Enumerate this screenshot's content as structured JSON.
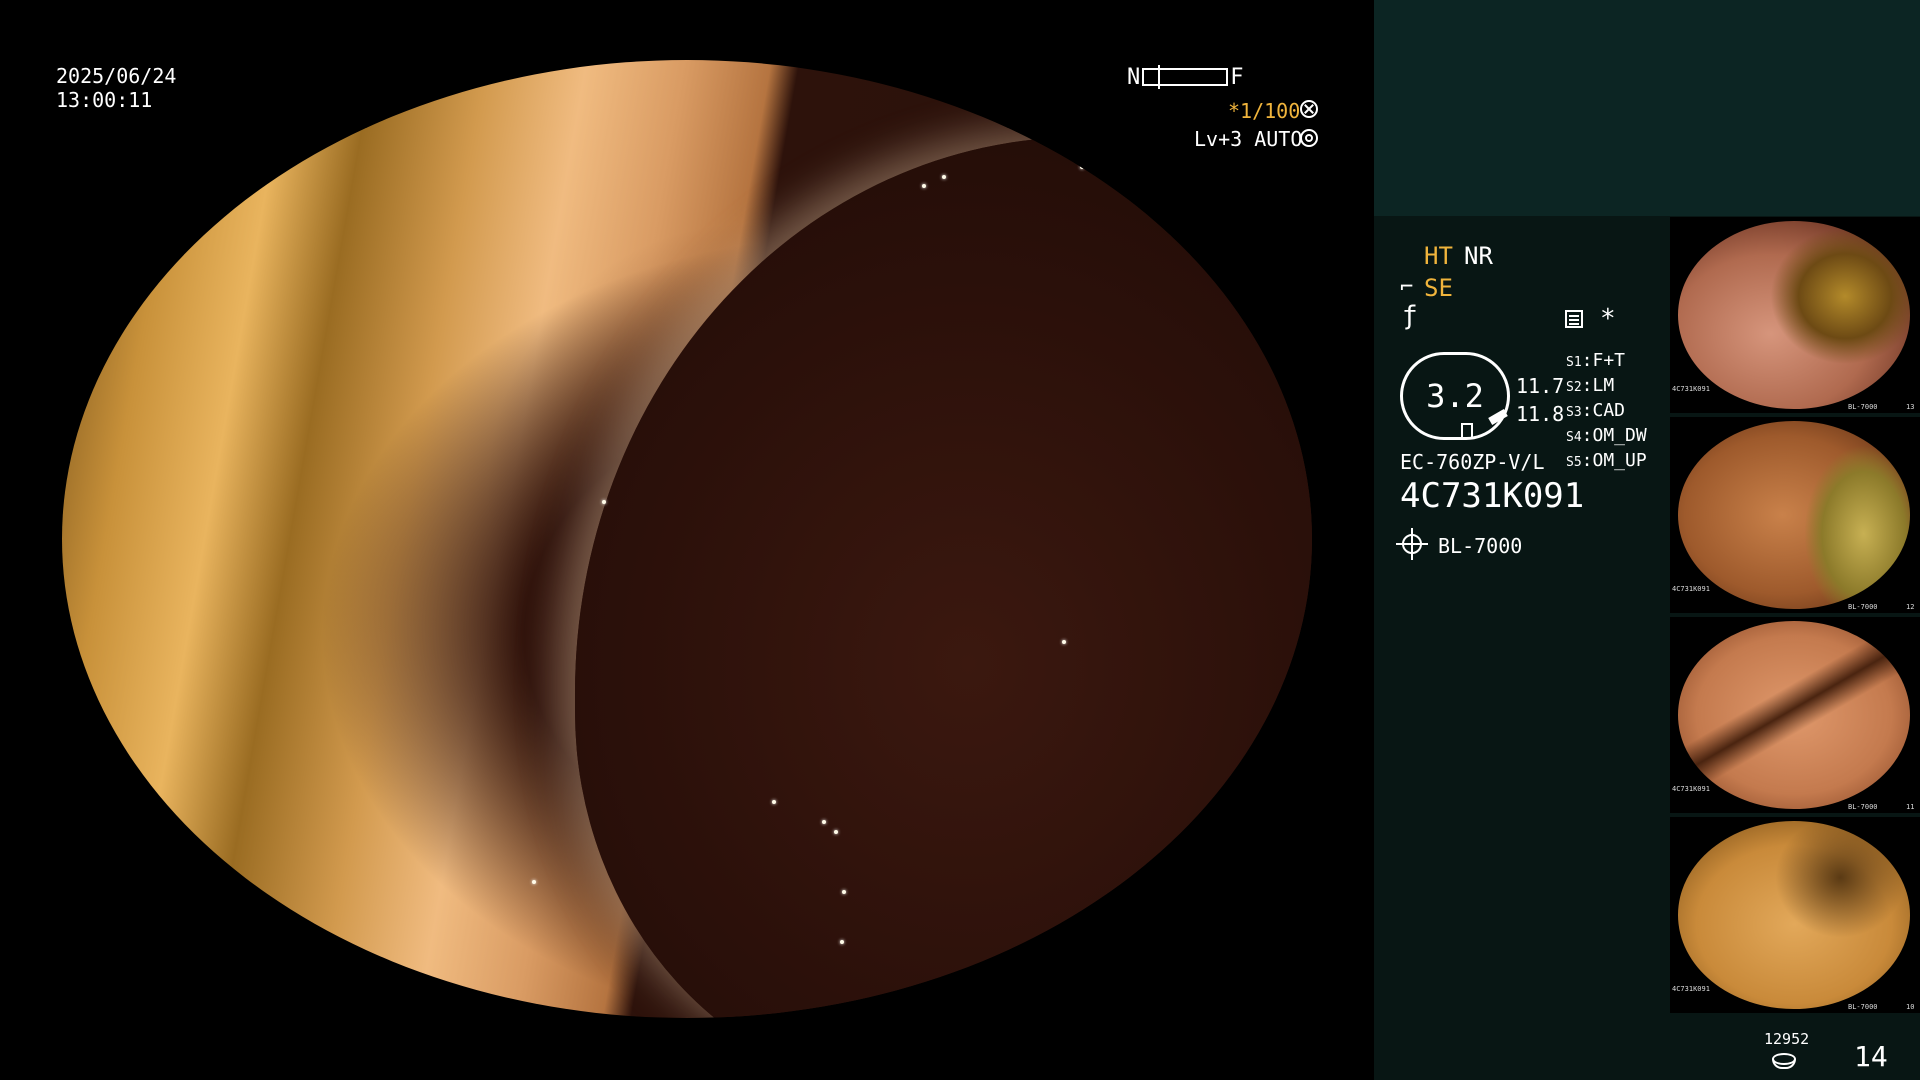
{
  "overlay": {
    "date": "2025/06/24",
    "time": "13:00:11",
    "near_label": "N",
    "far_label": "F",
    "shutter": "*1/100",
    "level": "Lv+3 AUTO"
  },
  "settings": {
    "ht": "HT",
    "nr": "NR",
    "se": "SE",
    "asterisk": "*",
    "scope_badge": "3.2",
    "values": [
      "11.7",
      "11.8"
    ],
    "switches": [
      {
        "key": "S1",
        "value": "F+T"
      },
      {
        "key": "S2",
        "value": "LM"
      },
      {
        "key": "S3",
        "value": "CAD"
      },
      {
        "key": "S4",
        "value": "OM_DW"
      },
      {
        "key": "S5",
        "value": "OM_UP"
      }
    ],
    "scope_model": "EC-760ZP-V/L",
    "scope_serial": "4C731K091",
    "light_source": "BL-7000"
  },
  "thumbnails": [
    {
      "serial": "4C731K091",
      "index": "13",
      "light": "BL-7000"
    },
    {
      "serial": "4C731K091",
      "index": "12",
      "light": "BL-7000"
    },
    {
      "serial": "4C731K091",
      "index": "11",
      "light": "BL-7000"
    },
    {
      "serial": "4C731K091",
      "index": "10",
      "light": "BL-7000"
    }
  ],
  "footer": {
    "storage_count": "12952",
    "page_number": "14"
  },
  "icons": [
    "shutter-icon",
    "iris-icon",
    "se-icon",
    "f-icon",
    "sheet-icon",
    "lamp-icon",
    "storage-icon"
  ],
  "colors": {
    "highlight": "#f0b43c",
    "panel": "#081614",
    "panel_header": "#0c2523"
  }
}
